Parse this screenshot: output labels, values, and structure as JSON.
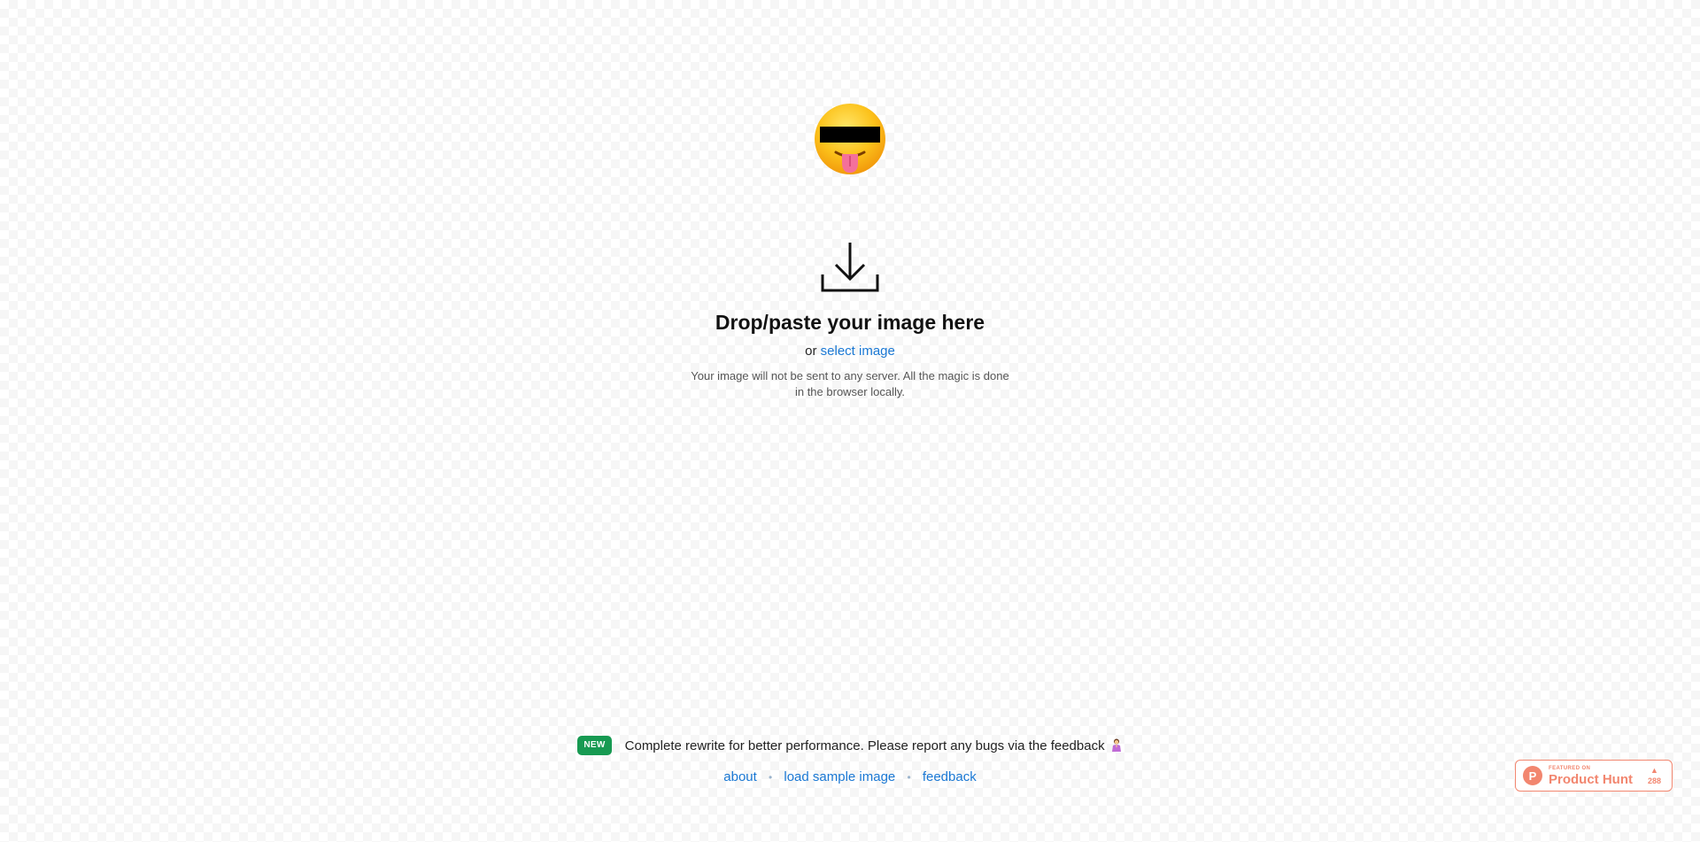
{
  "dropzone": {
    "title": "Drop/paste your image here",
    "or_text": "or",
    "select_link": "select image",
    "privacy_note": "Your image will not be sent to any server. All the magic is done in the browser locally."
  },
  "announcement": {
    "badge": "NEW",
    "text": "Complete rewrite for better performance. Please report any bugs via the feedback"
  },
  "footer": {
    "links": [
      "about",
      "load sample image",
      "feedback"
    ],
    "separator": "•"
  },
  "product_hunt": {
    "featured_on": "FEATURED ON",
    "name": "Product Hunt",
    "votes": "288"
  },
  "icons": {
    "logo": "tongue-face-censored-emoji-icon",
    "drop": "download-tray-icon",
    "pray": "praying-person-icon"
  },
  "colors": {
    "link": "#1a78d4",
    "badge_new": "#179a52",
    "product_hunt": "#f2866f"
  }
}
